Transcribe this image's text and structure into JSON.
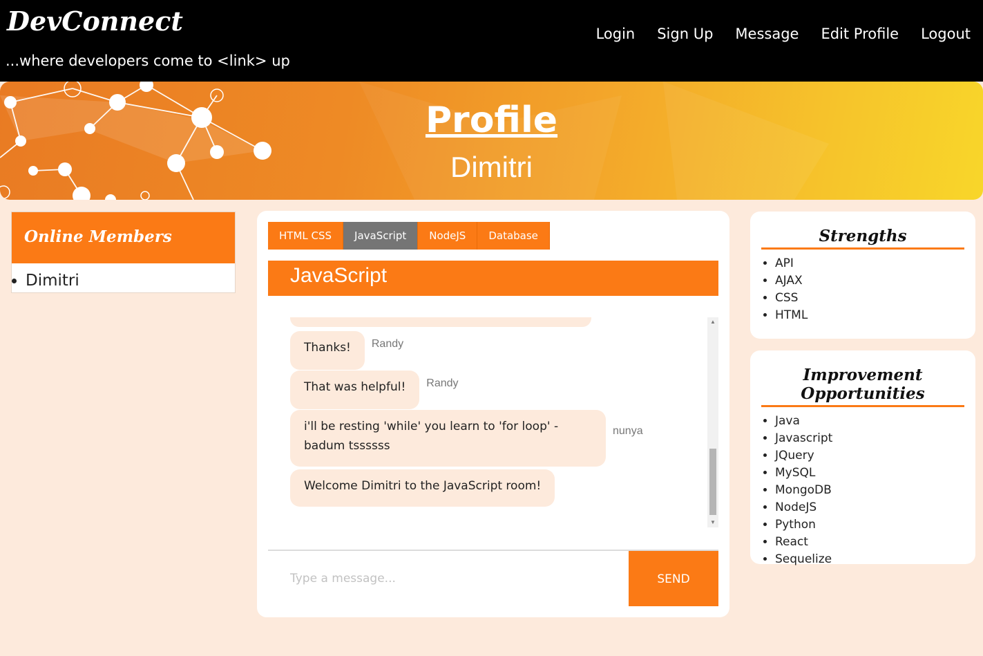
{
  "navbar": {
    "brand": "DevConnect",
    "tagline": "...where developers come to <link> up",
    "links": [
      "Login",
      "Sign Up",
      "Message",
      "Edit Profile",
      "Logout"
    ]
  },
  "hero": {
    "title": "Profile",
    "name": "Dimitri"
  },
  "online_members": {
    "title": "Online Members",
    "members": [
      "Dimitri"
    ]
  },
  "chat": {
    "tabs": [
      "HTML CSS",
      "JavaScript",
      "NodeJS",
      "Database"
    ],
    "active_tab": "JavaScript",
    "room_title": "JavaScript",
    "messages": [
      {
        "text": "Thanks!",
        "sender": "Randy"
      },
      {
        "text": "That was helpful!",
        "sender": "Randy"
      },
      {
        "text": "i'll be resting 'while' you learn to 'for loop' - badum tssssss",
        "sender": "nunya"
      },
      {
        "text": "Welcome Dimitri to the JavaScript room!",
        "sender": ""
      }
    ],
    "input_placeholder": "Type a message...",
    "send_label": "SEND"
  },
  "strengths": {
    "title": "Strengths",
    "items": [
      "API",
      "AJAX",
      "CSS",
      "HTML"
    ]
  },
  "improvements": {
    "title": "Improvement Opportunities",
    "items": [
      "Java",
      "Javascript",
      "JQuery",
      "MySQL",
      "MongoDB",
      "NodeJS",
      "Python",
      "React",
      "Sequelize"
    ]
  },
  "colors": {
    "accent": "#fb7a15",
    "active_tab": "#757575",
    "page_bg": "#fdeadc",
    "navbar_bg": "#000000"
  }
}
